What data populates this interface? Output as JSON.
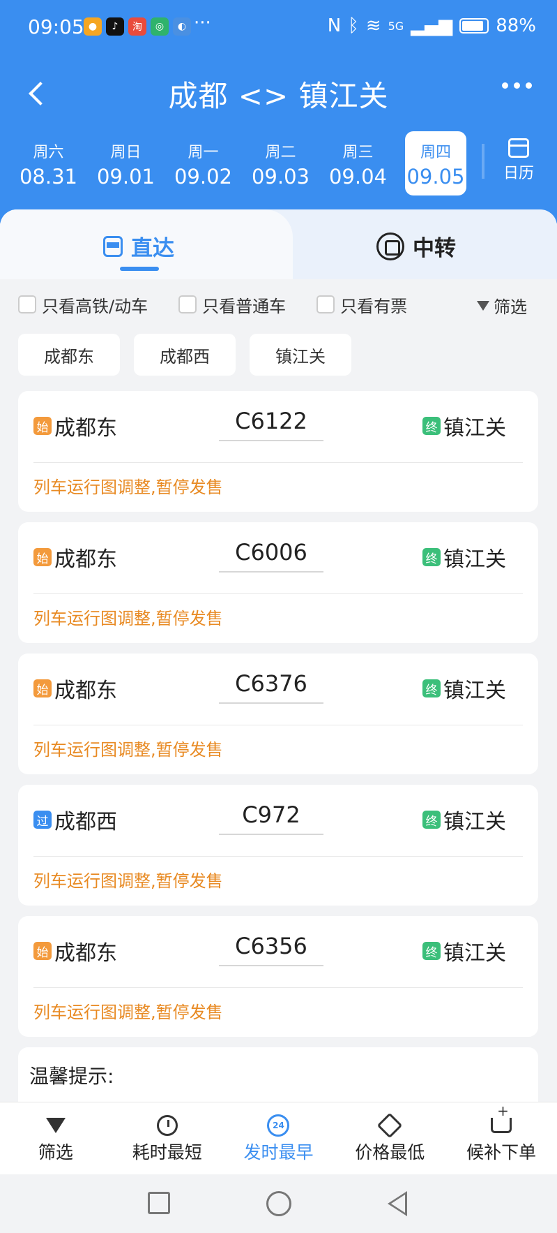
{
  "status": {
    "time": "09:05",
    "more": "···",
    "battery": "88%",
    "signal": "5G"
  },
  "header": {
    "title": "成都 <> 镇江关",
    "dates": [
      {
        "weekday": "周六",
        "date": "08.31"
      },
      {
        "weekday": "周日",
        "date": "09.01"
      },
      {
        "weekday": "周一",
        "date": "09.02"
      },
      {
        "weekday": "周二",
        "date": "09.03"
      },
      {
        "weekday": "周三",
        "date": "09.04"
      },
      {
        "weekday": "周四",
        "date": "09.05"
      }
    ],
    "calendar_label": "日历"
  },
  "tabs": {
    "direct": "直达",
    "transfer": "中转"
  },
  "filters": {
    "high_speed": "只看高铁/动车",
    "normal": "只看普通车",
    "has_ticket": "只看有票",
    "filter": "筛选"
  },
  "stations": [
    "成都东",
    "成都西",
    "镇江关"
  ],
  "trains": [
    {
      "badge": "始",
      "from": "成都东",
      "train": "C6122",
      "end_badge": "终",
      "to": "镇江关",
      "note": "列车运行图调整,暂停发售"
    },
    {
      "badge": "始",
      "from": "成都东",
      "train": "C6006",
      "end_badge": "终",
      "to": "镇江关",
      "note": "列车运行图调整,暂停发售"
    },
    {
      "badge": "始",
      "from": "成都东",
      "train": "C6376",
      "end_badge": "终",
      "to": "镇江关",
      "note": "列车运行图调整,暂停发售"
    },
    {
      "badge": "过",
      "from": "成都西",
      "train": "C972",
      "end_badge": "终",
      "to": "镇江关",
      "note": "列车运行图调整,暂停发售"
    },
    {
      "badge": "始",
      "from": "成都东",
      "train": "C6356",
      "end_badge": "终",
      "to": "镇江关",
      "note": "列车运行图调整,暂停发售"
    }
  ],
  "tip": "温馨提示:",
  "toolbar": {
    "filter": "筛选",
    "shortest": "耗时最短",
    "earliest": "发时最早",
    "cheapest": "价格最低",
    "waitlist": "候补下单",
    "icon_24": "24"
  },
  "colors": {
    "primary": "#3a8ef0",
    "warning": "#e88a23",
    "start_badge": "#f39a3c",
    "end_badge": "#3bbf7a"
  }
}
